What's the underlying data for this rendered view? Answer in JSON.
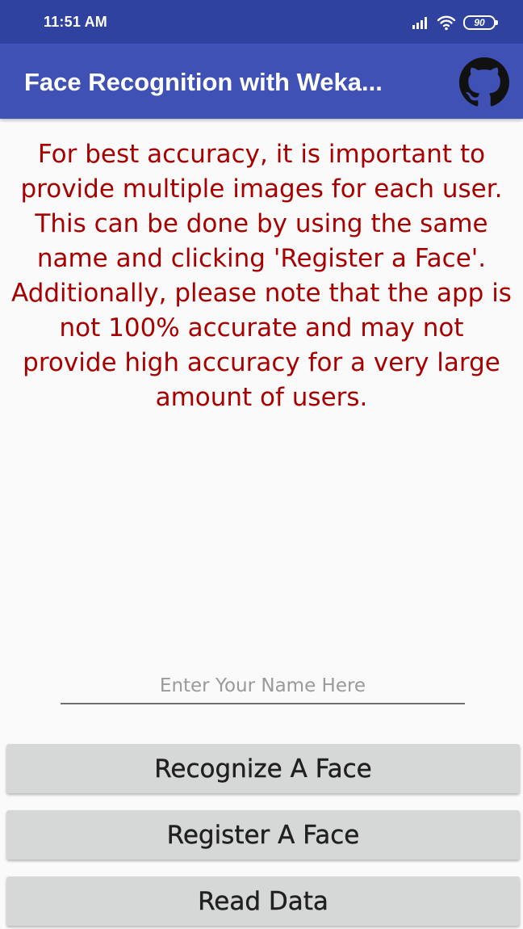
{
  "status_bar": {
    "time": "11:51 AM",
    "battery": "90",
    "icons": [
      "signal-icon",
      "wifi-icon",
      "battery-icon"
    ]
  },
  "app_bar": {
    "title": "Face Recognition with Weka...",
    "action_icon": "github-icon"
  },
  "notice": {
    "text": "For best accuracy, it is important to provide multiple images for each user. This can be done by using the same name and clicking 'Register a Face'. Additionally, please note that the app is not 100% accurate and may not provide high accuracy for a very large amount of users."
  },
  "name_input": {
    "value": "",
    "placeholder": "Enter Your Name Here"
  },
  "buttons": {
    "recognize": "Recognize A Face",
    "register": "Register A Face",
    "read_data": "Read Data"
  },
  "colors": {
    "status_bar": "#2f42a0",
    "app_bar": "#3f51b5",
    "notice_text": "#a80000",
    "button_bg": "#d6d7d7",
    "background": "#fafafa"
  }
}
